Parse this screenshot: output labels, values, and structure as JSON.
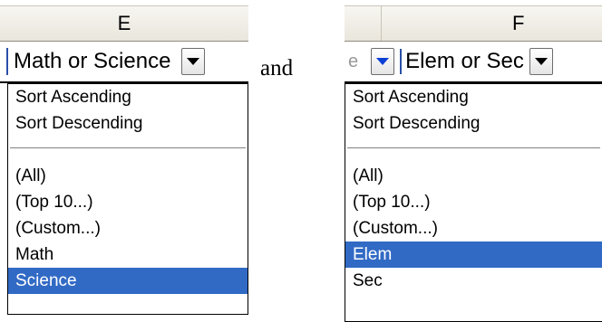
{
  "conjunction": "and",
  "left": {
    "column_letter": "E",
    "cell_text": "Math or Science",
    "menu_items": [
      {
        "label": "Sort Ascending",
        "selected": false
      },
      {
        "label": "Sort Descending",
        "selected": false
      },
      {
        "label": "(All)",
        "selected": false
      },
      {
        "label": "(Top 10...)",
        "selected": false
      },
      {
        "label": "(Custom...)",
        "selected": false
      },
      {
        "label": "Math",
        "selected": false
      },
      {
        "label": "Science",
        "selected": true
      }
    ]
  },
  "right": {
    "column_letter": "F",
    "partial_left_text": "e",
    "cell_text": "Elem or Sec",
    "menu_items": [
      {
        "label": "Sort Ascending",
        "selected": false
      },
      {
        "label": "Sort Descending",
        "selected": false
      },
      {
        "label": "(All)",
        "selected": false
      },
      {
        "label": "(Top 10...)",
        "selected": false
      },
      {
        "label": "(Custom...)",
        "selected": false
      },
      {
        "label": "Elem",
        "selected": true
      },
      {
        "label": "Sec",
        "selected": false
      }
    ]
  },
  "colors": {
    "selection": "#316ac5",
    "active_filter_arrow": "#0b3fd6"
  }
}
